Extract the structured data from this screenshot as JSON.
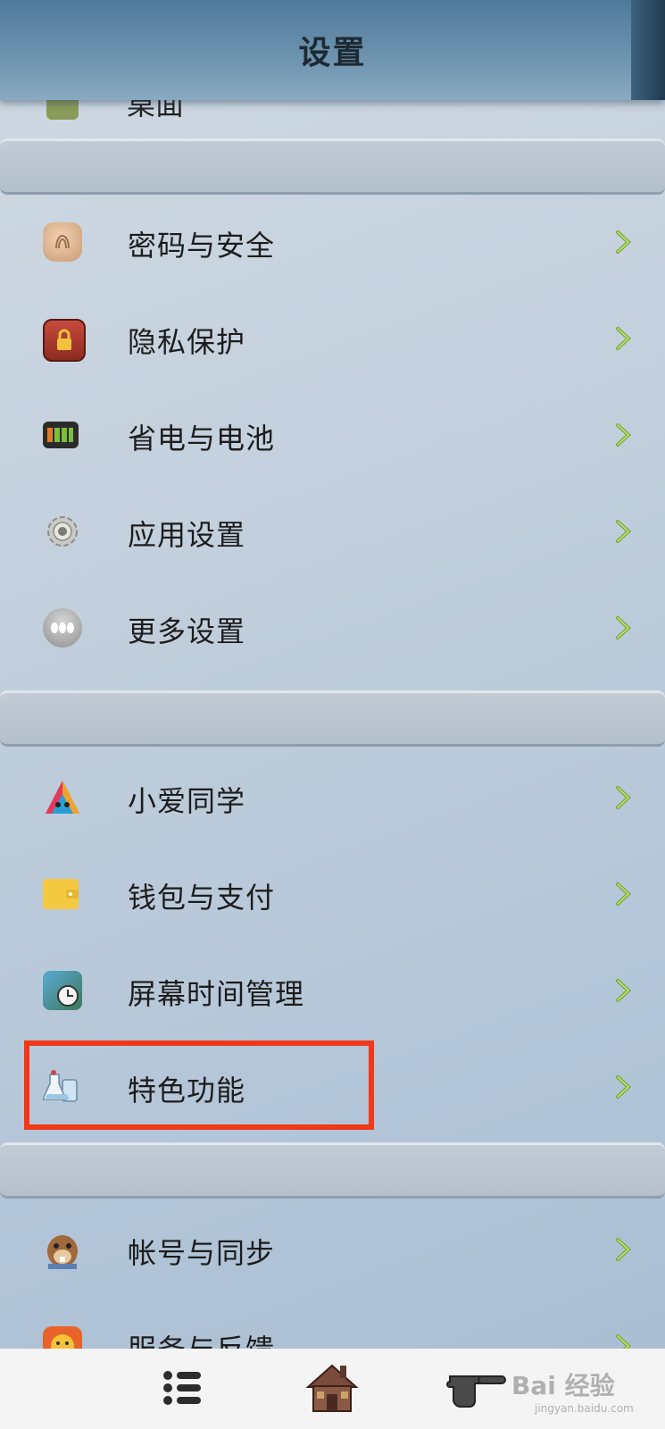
{
  "header": {
    "title": "设置"
  },
  "partial_top_item": {
    "label": "桌面"
  },
  "groups": [
    {
      "items": [
        {
          "label": "密码与安全",
          "icon": "fingerprint-icon"
        },
        {
          "label": "隐私保护",
          "icon": "privacy-lock-icon"
        },
        {
          "label": "省电与电池",
          "icon": "battery-icon"
        },
        {
          "label": "应用设置",
          "icon": "gear-icon"
        },
        {
          "label": "更多设置",
          "icon": "more-dots-icon"
        }
      ]
    },
    {
      "items": [
        {
          "label": "小爱同学",
          "icon": "xiaoai-assistant-icon"
        },
        {
          "label": "钱包与支付",
          "icon": "wallet-icon"
        },
        {
          "label": "屏幕时间管理",
          "icon": "screen-time-icon"
        },
        {
          "label": "特色功能",
          "icon": "lab-flask-icon"
        }
      ]
    },
    {
      "items": [
        {
          "label": "帐号与同步",
          "icon": "beaver-account-icon"
        },
        {
          "label": "服务与反馈",
          "icon": "smiley-feedback-icon"
        }
      ]
    }
  ],
  "bottom_nav": [
    {
      "icon": "list-menu-icon"
    },
    {
      "icon": "home-house-icon"
    },
    {
      "icon": "pointing-hand-icon"
    }
  ],
  "watermark": {
    "main": "Bai 经验",
    "sub": "jingyan.baidu.com"
  },
  "colors": {
    "highlight": "#f0381a",
    "chevron": "#8cc63f",
    "header": "#5f88a6"
  }
}
